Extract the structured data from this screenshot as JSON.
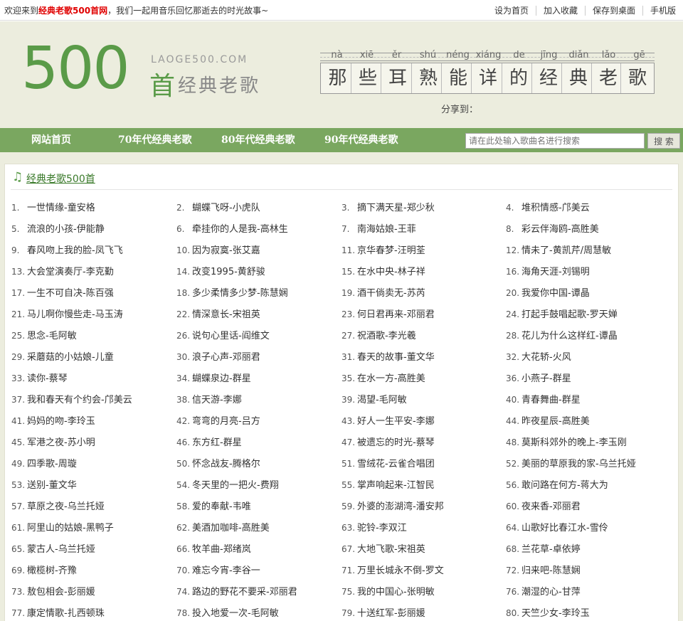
{
  "topbar": {
    "welcome_pre": "欢迎来到",
    "welcome_brand": "经典老歌500首网",
    "welcome_post": "，我们一起用音乐回忆那逝去的时光故事~",
    "links": [
      "设为首页",
      "加入收藏",
      "保存到桌面",
      "手机版"
    ]
  },
  "header": {
    "logo_number": "500",
    "logo_domain": "LAOGE500.COM",
    "logo_shou": "首",
    "logo_sub": "经典老歌",
    "pinyin": [
      "nà",
      "xiē",
      "ěr",
      "shú",
      "néng",
      "xiáng",
      "de",
      "jīng",
      "diǎn",
      "lǎo",
      "gē"
    ],
    "chars": [
      "那",
      "些",
      "耳",
      "熟",
      "能",
      "详",
      "的",
      "经",
      "典",
      "老",
      "歌"
    ],
    "share_label": "分享到："
  },
  "nav": {
    "items": [
      "网站首页",
      "70年代经典老歌",
      "80年代经典老歌",
      "90年代经典老歌"
    ],
    "search_placeholder": "请在此处输入歌曲名进行搜索",
    "search_button": "搜 索"
  },
  "panel": {
    "title": "经典老歌500首",
    "icon": "music-note-icon"
  },
  "songs": [
    "一世情缘-童安格",
    "蝴蝶飞呀-小虎队",
    "摘下满天星-郑少秋",
    "堆积情感-邝美云",
    "流浪的小孩-伊能静",
    "牵挂你的人是我-高林生",
    "南海姑娘-王菲",
    "彩云伴海鸥-高胜美",
    "春风吻上我的脸-凤飞飞",
    "因为寂寞-张艾嘉",
    "京华春梦-汪明荃",
    "情未了-黄凯芹/周慧敏",
    "大会堂演奏厅-李克勤",
    "改变1995-黄舒骏",
    "在水中央-林子祥",
    "海角天涯-刘锡明",
    "一生不可自决-陈百强",
    "多少柔情多少梦-陈慧娴",
    "酒干倘卖无-苏芮",
    "我爱你中国-谭晶",
    "马儿啊你慢些走-马玉涛",
    "情深意长-宋祖英",
    "何日君再来-邓丽君",
    "打起手鼓唱起歌-罗天婵",
    "思念-毛阿敏",
    "说句心里话-阎维文",
    "祝酒歌-李光羲",
    "花儿为什么这样红-谭晶",
    "采蘑菇的小姑娘-儿童",
    "浪子心声-邓丽君",
    "春天的故事-董文华",
    "大花轿-火风",
    "读你-蔡琴",
    "蝴蝶泉边-群星",
    "在水一方-高胜美",
    "小燕子-群星",
    "我和春天有个约会-邝美云",
    "信天游-李娜",
    "渴望-毛阿敏",
    "青春舞曲-群星",
    "妈妈的吻-李玲玉",
    "弯弯的月亮-吕方",
    "好人一生平安-李娜",
    "昨夜星辰-高胜美",
    "军港之夜-苏小明",
    "东方红-群星",
    "被遗忘的时光-蔡琴",
    "莫斯科郊外的晚上-李玉刚",
    "四季歌-周璇",
    "怀念战友-腾格尔",
    "雪绒花-云雀合唱团",
    "美丽的草原我的家-乌兰托娅",
    "送别-董文华",
    "冬天里的一把火-费翔",
    "掌声响起来-江智民",
    "敢问路在何方-蒋大为",
    "草原之夜-乌兰托娅",
    "爱的奉献-韦唯",
    "外婆的澎湖湾-潘安邦",
    "夜来香-邓丽君",
    "阿里山的姑娘-黑鸭子",
    "美酒加咖啡-高胜美",
    "驼铃-李双江",
    "山歌好比春江水-雪伶",
    "蒙古人-乌兰托娅",
    "牧羊曲-郑绪岚",
    "大地飞歌-宋祖英",
    "兰花草-卓依婷",
    "橄榄树-齐豫",
    "难忘今宵-李谷一",
    "万里长城永不倒-罗文",
    "归来吧-陈慧娴",
    "敖包相会-彭丽媛",
    "路边的野花不要采-邓丽君",
    "我的中国心-张明敏",
    "潮湿的心-甘萍",
    "康定情歌-扎西顿珠",
    "投入地爱一次-毛阿敏",
    "十送红军-彭丽媛",
    "天竺少女-李玲玉"
  ]
}
